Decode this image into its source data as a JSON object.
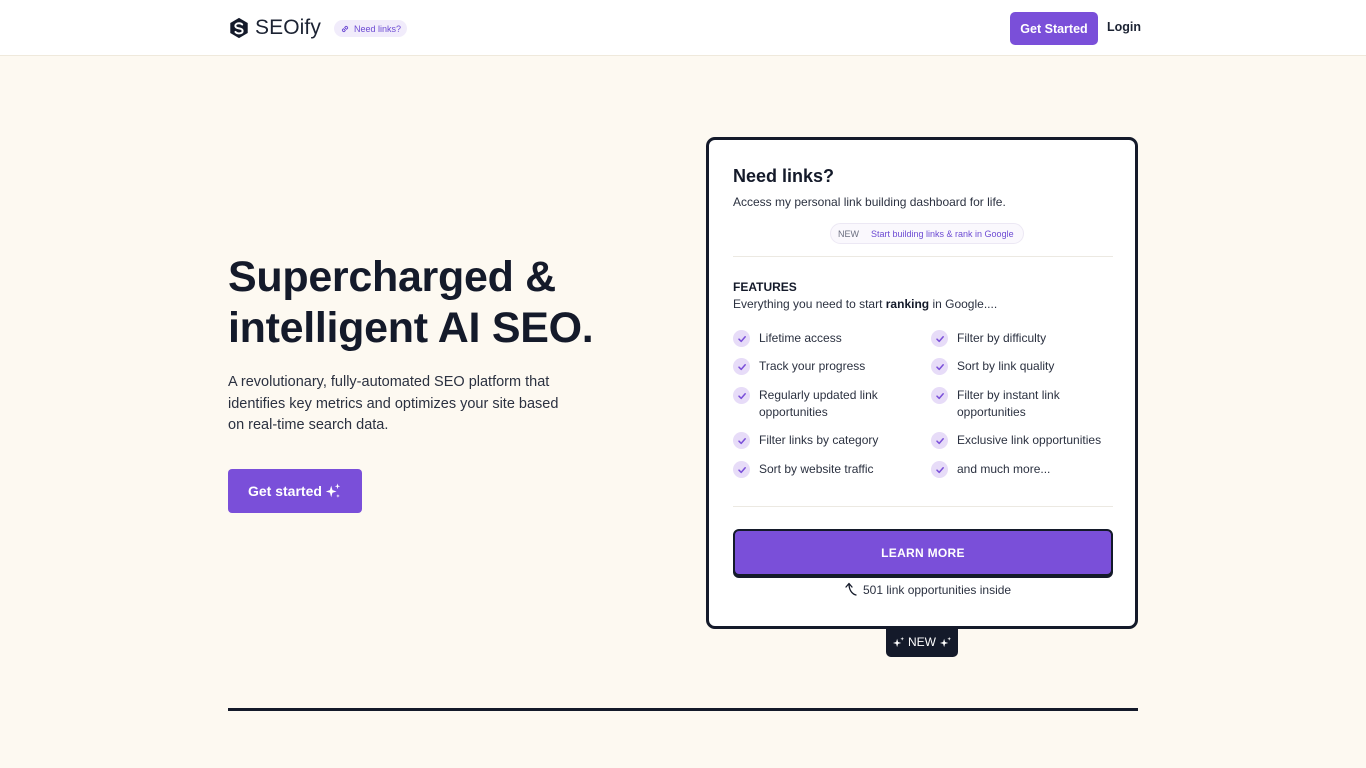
{
  "header": {
    "logo_text": "SEOify",
    "links_pill": "Need links?",
    "get_started": "Get Started",
    "login": "Login"
  },
  "hero": {
    "title": "Supercharged & intelligent AI SEO.",
    "subtitle": "A revolutionary, fully-automated SEO platform that identifies key metrics and optimizes your site based on real-time search data.",
    "cta": "Get started"
  },
  "card": {
    "title": "Need links?",
    "subtitle": "Access my personal link building dashboard for life.",
    "tag_new": "NEW",
    "tag_text": "Start building links & rank in Google",
    "features_title": "FEATURES",
    "features_sub_before": "Everything you need to start ",
    "features_sub_bold": "ranking",
    "features_sub_after": " in Google....",
    "features": [
      "Lifetime access",
      "Filter by difficulty",
      "Track your progress",
      "Sort by link quality",
      "Regularly updated link opportunities",
      "Filter by instant link opportunities",
      "Filter links by category",
      "Exclusive link opportunities",
      "Sort by website traffic",
      "and much more..."
    ],
    "learn_more": "LEARN MORE",
    "opportunities": "501 link opportunities inside"
  },
  "badge": {
    "label": "NEW"
  },
  "colors": {
    "accent": "#7a4fd9",
    "dark": "#141a2a",
    "background": "#fdf9f1",
    "check_bg": "#e7dcf8"
  }
}
